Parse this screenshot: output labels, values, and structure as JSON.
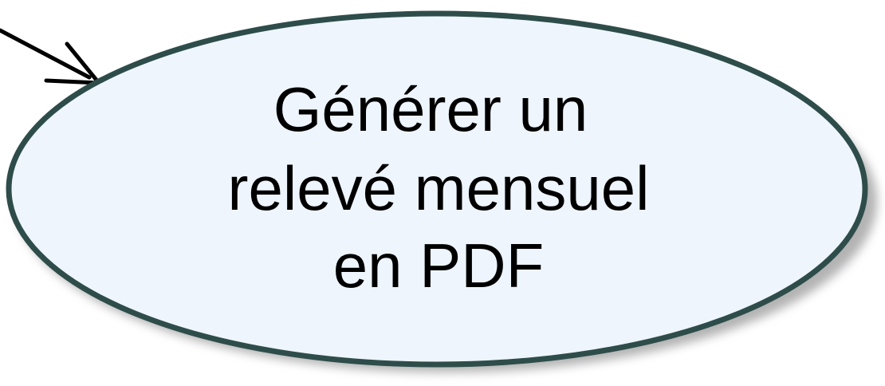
{
  "use_case": {
    "lines": [
      "Générer un",
      "relevé mensuel",
      "en PDF"
    ]
  },
  "colors": {
    "fill": "#eef5fd",
    "stroke": "#2e4d4a",
    "shadow": "#9a9a9a",
    "arrow": "#000000"
  }
}
